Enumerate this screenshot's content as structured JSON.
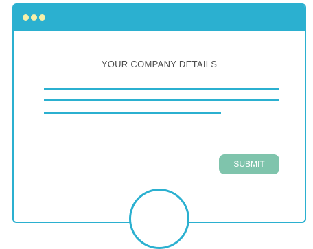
{
  "window": {
    "title_dots": [
      "dot",
      "dot",
      "dot"
    ]
  },
  "form": {
    "title": "YOUR COMPANY DETAILS",
    "submit_label": "SUBMIT"
  },
  "colors": {
    "accent": "#2bb0d0",
    "dot": "#f7f0a8",
    "submit_bg": "#7fc4ac",
    "text": "#4d4d4d"
  }
}
